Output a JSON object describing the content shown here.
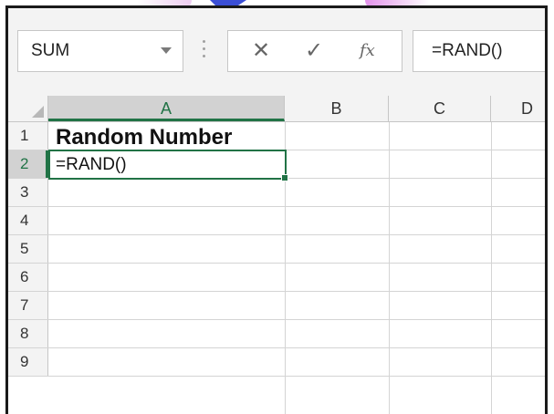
{
  "name_box": {
    "value": "SUM"
  },
  "formula_bar": {
    "cancel_icon": "close-icon",
    "enter_icon": "check-icon",
    "fx_label": "fx",
    "value": "=RAND()"
  },
  "columns": [
    "A",
    "B",
    "C",
    "D"
  ],
  "rows": [
    "1",
    "2",
    "3",
    "4",
    "5",
    "6",
    "7",
    "8",
    "9"
  ],
  "cells": {
    "A1": "Random Number",
    "A2": "=RAND()"
  },
  "colors": {
    "accent": "#217346",
    "header_bg": "#f3f3f3",
    "selected_header_bg": "#d2d2d2"
  }
}
